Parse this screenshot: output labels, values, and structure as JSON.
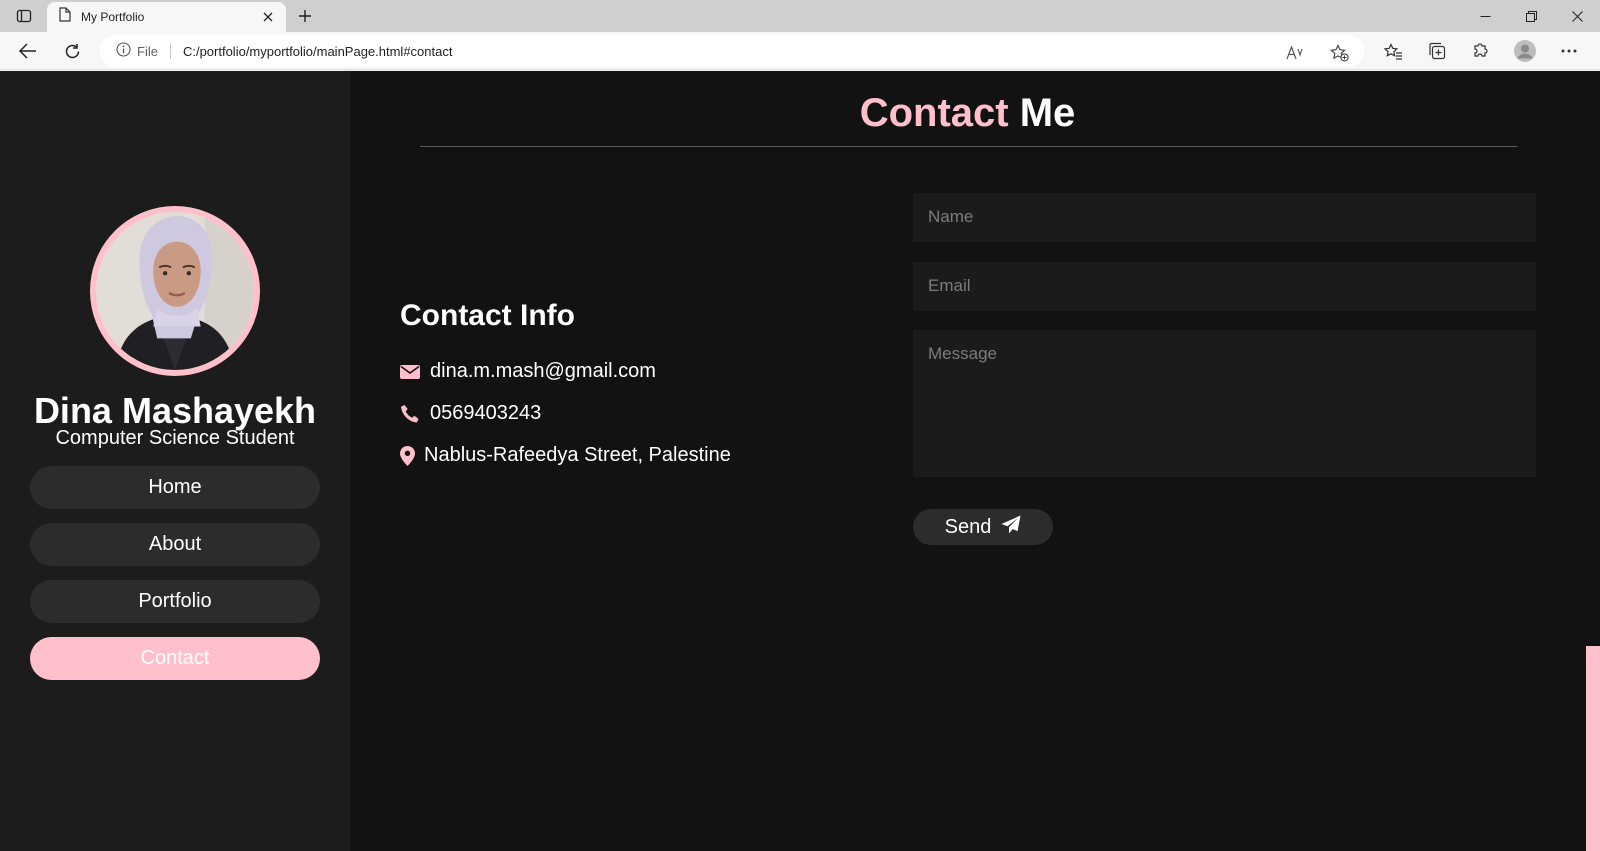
{
  "browser": {
    "tab_title": "My Portfolio",
    "address_prefix": "File",
    "url": "C:/portfolio/myportfolio/mainPage.html#contact"
  },
  "sidebar": {
    "name": "Dina Mashayekh",
    "role": "Computer Science Student",
    "nav": [
      {
        "label": "Home"
      },
      {
        "label": "About"
      },
      {
        "label": "Portfolio"
      },
      {
        "label": "Contact"
      }
    ],
    "active_nav": "Contact"
  },
  "main": {
    "title_part1": "Contact",
    "title_part2": "Me",
    "contact_info": {
      "heading": "Contact Info",
      "email": "dina.m.mash@gmail.com",
      "phone": "0569403243",
      "address": "Nablus-Rafeedya Street, Palestine"
    },
    "form": {
      "name_placeholder": "Name",
      "email_placeholder": "Email",
      "message_placeholder": "Message",
      "send_label": "Send"
    }
  },
  "colors": {
    "accent": "#ffc0cb",
    "page_bg": "#121212",
    "sidebar_bg": "#1c1c1c",
    "button_bg": "#2c2c2c"
  },
  "icons": [
    "sidebar-toggle-icon",
    "page-icon",
    "close-icon",
    "plus-icon",
    "minimize-icon",
    "restore-icon",
    "back-icon",
    "refresh-icon",
    "info-icon",
    "read-aloud-icon",
    "add-favorite-icon",
    "favorites-icon",
    "collections-icon",
    "extensions-icon",
    "profile-icon",
    "more-icon",
    "envelope-icon",
    "phone-icon",
    "location-pin-icon",
    "paper-plane-icon"
  ]
}
